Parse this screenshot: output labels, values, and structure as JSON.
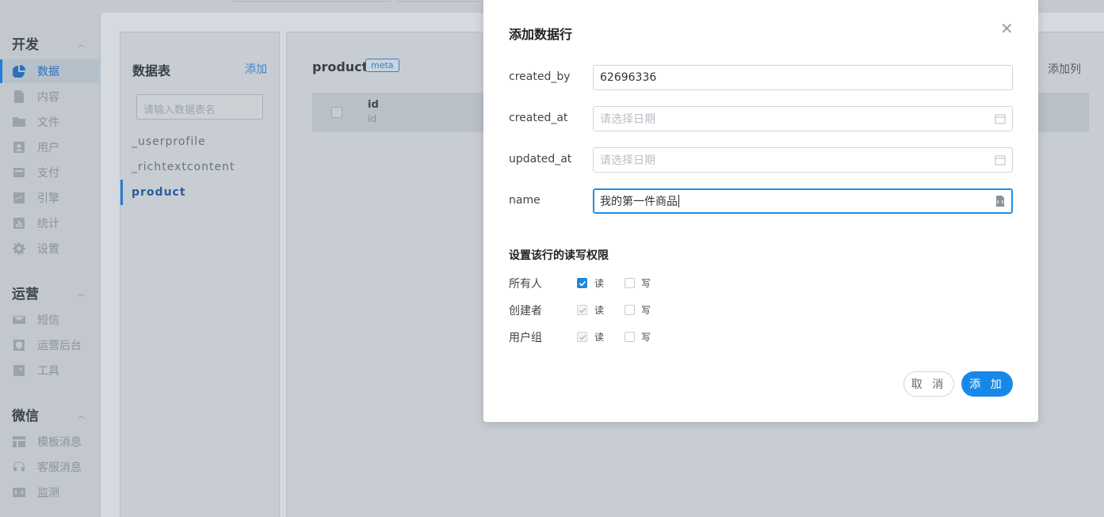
{
  "sidebar": {
    "sections": [
      {
        "title": "开发",
        "items": [
          {
            "label": "数据",
            "icon": "pie-chart-icon",
            "active": true
          },
          {
            "label": "内容",
            "icon": "document-icon"
          },
          {
            "label": "文件",
            "icon": "folder-icon"
          },
          {
            "label": "用户",
            "icon": "user-card-icon"
          },
          {
            "label": "支付",
            "icon": "wallet-icon"
          },
          {
            "label": "引擎",
            "icon": "trend-chart-icon"
          },
          {
            "label": "统计",
            "icon": "bar-chart-icon"
          },
          {
            "label": "设置",
            "icon": "gear-icon"
          }
        ]
      },
      {
        "title": "运营",
        "items": [
          {
            "label": "短信",
            "icon": "mail-icon"
          },
          {
            "label": "运营后台",
            "icon": "shield-icon"
          },
          {
            "label": "工具",
            "icon": "wrench-icon"
          }
        ]
      },
      {
        "title": "微信",
        "items": [
          {
            "label": "模板消息",
            "icon": "template-icon"
          },
          {
            "label": "客服消息",
            "icon": "headset-icon"
          },
          {
            "label": "监测",
            "icon": "code-icon"
          }
        ]
      }
    ]
  },
  "tables_panel": {
    "title": "数据表",
    "add_label": "添加",
    "search_placeholder": "请输入数据表名",
    "items": [
      "_userprofile",
      "_richtextcontent",
      "product"
    ],
    "active_item": "product"
  },
  "main_panel": {
    "table_name": "product",
    "badge": "meta",
    "add_column_label": "添加列",
    "columns": [
      {
        "name": "id",
        "type": "id"
      }
    ]
  },
  "modal": {
    "title": "添加数据行",
    "fields": [
      {
        "label": "created_by",
        "value": "62696336",
        "placeholder": ""
      },
      {
        "label": "created_at",
        "value": "",
        "placeholder": "请选择日期"
      },
      {
        "label": "updated_at",
        "value": "",
        "placeholder": "请选择日期"
      },
      {
        "label": "name",
        "value": "我的第一件商品",
        "placeholder": ""
      }
    ],
    "permissions_title": "设置该行的读写权限",
    "permissions": [
      {
        "role": "所有人",
        "read_label": "读",
        "write_label": "写",
        "read": true,
        "write": false
      },
      {
        "role": "创建者",
        "read_label": "读",
        "write_label": "写",
        "read": true,
        "write": false
      },
      {
        "role": "用户组",
        "read_label": "读",
        "write_label": "写",
        "read": true,
        "write": false
      }
    ],
    "cancel_label": "取 消",
    "submit_label": "添 加"
  },
  "colors": {
    "accent": "#1888e8",
    "overlay": "#c8cdd3"
  }
}
